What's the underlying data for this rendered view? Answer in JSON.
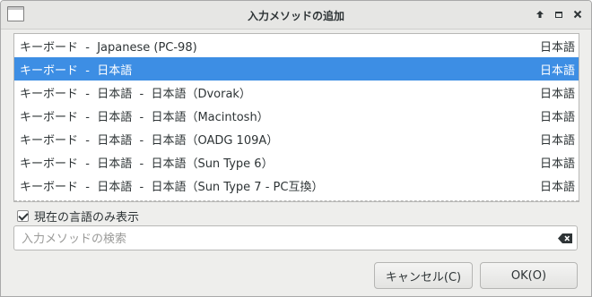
{
  "window": {
    "title": "入力メソッドの追加",
    "controls": [
      "arrow-up-icon",
      "maximize-icon",
      "close-icon"
    ]
  },
  "list": {
    "items": [
      {
        "name": "キーボード  -  Japanese (PC-98)",
        "lang": "日本語",
        "selected": false
      },
      {
        "name": "キーボード  -  日本語",
        "lang": "日本語",
        "selected": true
      },
      {
        "name": "キーボード  -  日本語  -  日本語（Dvorak）",
        "lang": "日本語",
        "selected": false
      },
      {
        "name": "キーボード  -  日本語  -  日本語（Macintosh）",
        "lang": "日本語",
        "selected": false
      },
      {
        "name": "キーボード  -  日本語  -  日本語（OADG 109A）",
        "lang": "日本語",
        "selected": false
      },
      {
        "name": "キーボード  -  日本語  -  日本語（Sun Type 6）",
        "lang": "日本語",
        "selected": false
      },
      {
        "name": "キーボード  -  日本語  -  日本語（Sun Type 7 - PC互換）",
        "lang": "日本語",
        "selected": false
      }
    ]
  },
  "filter": {
    "label": "現在の言語のみ表示",
    "checked": true
  },
  "search": {
    "value": "",
    "placeholder": "入力メソッドの検索"
  },
  "buttons": {
    "cancel_label": "キャンセル(C)",
    "ok_label": "OK(O)"
  },
  "colors": {
    "selection": "#3d8ee4",
    "background": "#eeeeec"
  }
}
